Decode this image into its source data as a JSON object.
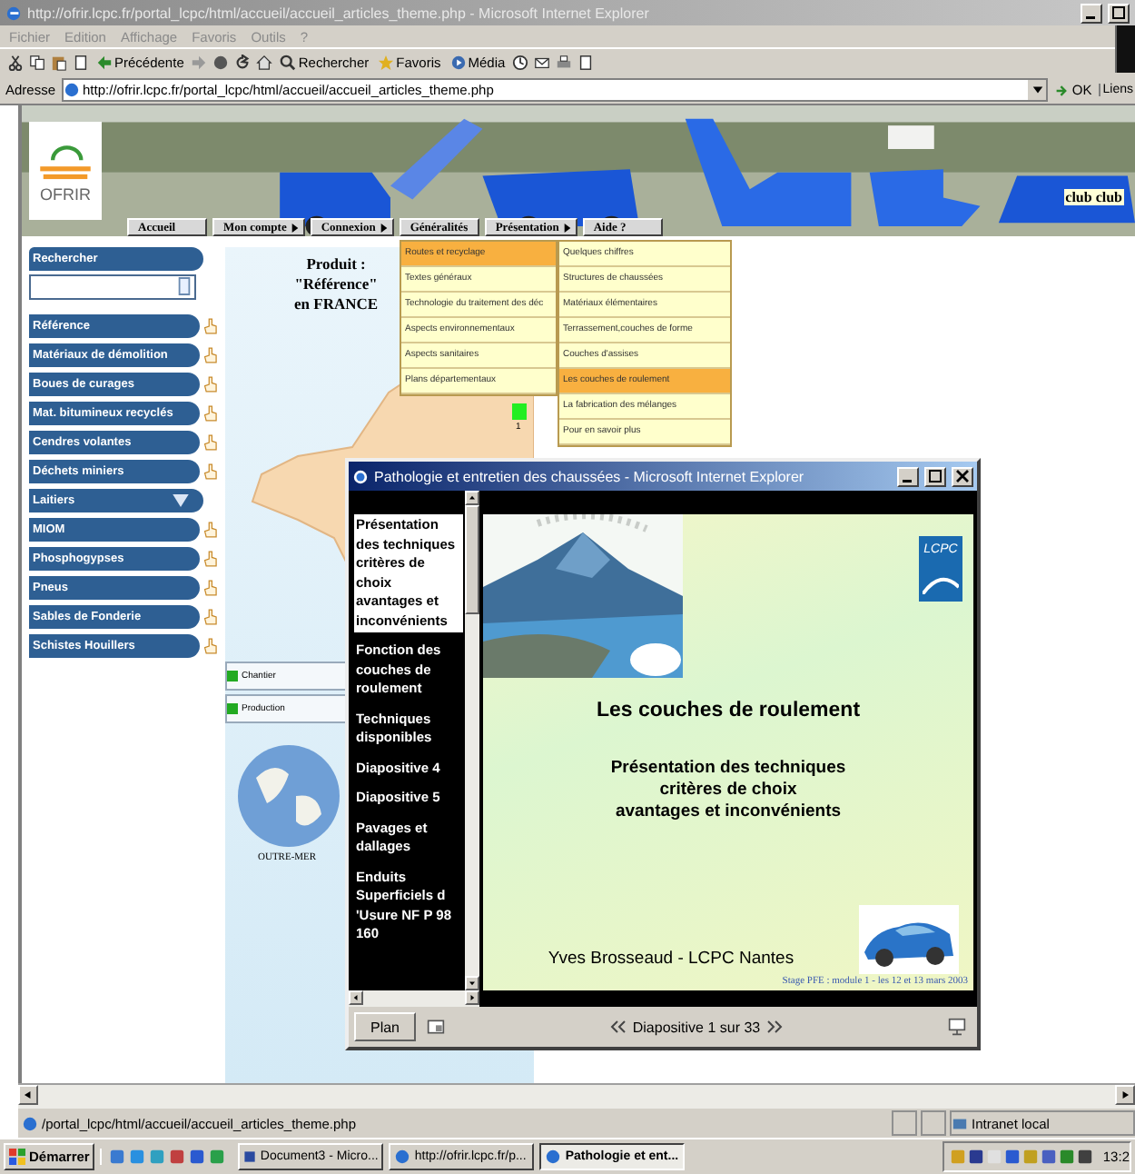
{
  "window": {
    "title": "http://ofrir.lcpc.fr/portal_lcpc/html/accueil/accueil_articles_theme.php - Microsoft Internet Explorer"
  },
  "menu_bar": [
    "Fichier",
    "Edition",
    "Affichage",
    "Favoris",
    "Outils",
    "?"
  ],
  "toolbar": [
    {
      "kind": "cut"
    },
    {
      "kind": "copy"
    },
    {
      "kind": "paste"
    },
    {
      "kind": "preview"
    },
    {
      "kind": "back",
      "label": "Précédente"
    },
    {
      "kind": "forward"
    },
    {
      "kind": "stop"
    },
    {
      "kind": "refresh"
    },
    {
      "kind": "home"
    },
    {
      "kind": "search",
      "label": "Rechercher"
    },
    {
      "kind": "favorites",
      "label": "Favoris"
    },
    {
      "kind": "media",
      "label": "Média"
    },
    {
      "kind": "history"
    },
    {
      "kind": "mail"
    },
    {
      "kind": "print"
    },
    {
      "kind": "edit"
    }
  ],
  "address_bar": {
    "label": "Adresse",
    "value": "http://ofrir.lcpc.fr/portal_lcpc/html/accueil/accueil_articles_theme.php",
    "go": "OK",
    "links": "Liens"
  },
  "site": {
    "logo": "OFRIR",
    "club": "club club",
    "nav": [
      {
        "label": "Accueil",
        "arrow": false
      },
      {
        "label": "Mon compte",
        "arrow": true
      },
      {
        "label": "Connexion",
        "arrow": true
      },
      {
        "label": "Généralités",
        "arrow": false
      },
      {
        "label": "Présentation",
        "arrow": true
      },
      {
        "label": "Aide ?",
        "arrow": false
      }
    ],
    "dropdown": {
      "column_1": [
        {
          "label": "Routes et recyclage",
          "selected": true
        },
        {
          "label": "Textes généraux",
          "selected": false
        },
        {
          "label": "Technologie du traitement des déc",
          "selected": false
        },
        {
          "label": "Aspects environnementaux",
          "selected": false
        },
        {
          "label": "Aspects sanitaires",
          "selected": false
        },
        {
          "label": "Plans départementaux",
          "selected": false
        }
      ],
      "column_2": [
        {
          "label": "Quelques chiffres",
          "selected": false
        },
        {
          "label": "Structures de chaussées",
          "selected": false
        },
        {
          "label": "Matériaux élémentaires",
          "selected": false
        },
        {
          "label": "Terrassement,couches de forme",
          "selected": false
        },
        {
          "label": "Couches d'assises",
          "selected": false
        },
        {
          "label": "Les couches de roulement",
          "selected": true
        },
        {
          "label": "La fabrication des mélanges",
          "selected": false
        },
        {
          "label": "Pour en savoir plus",
          "selected": false
        }
      ]
    },
    "sidebar": {
      "search_label": "Rechercher",
      "items": [
        {
          "label": "Référence",
          "kind": "link"
        },
        {
          "label": "Matériaux de démolition",
          "kind": "link"
        },
        {
          "label": "Boues de curages",
          "kind": "link"
        },
        {
          "label": "Mat. bitumineux recyclés",
          "kind": "link"
        },
        {
          "label": "Cendres volantes",
          "kind": "link"
        },
        {
          "label": "Déchets miniers",
          "kind": "link"
        },
        {
          "label": "Laitiers",
          "kind": "submenu"
        },
        {
          "label": "MIOM",
          "kind": "link"
        },
        {
          "label": "Phosphogypses",
          "kind": "link"
        },
        {
          "label": "Pneus",
          "kind": "link"
        },
        {
          "label": "Sables de Fonderie",
          "kind": "link"
        },
        {
          "label": "Schistes Houillers",
          "kind": "link"
        }
      ]
    },
    "map": {
      "heading": [
        "Produit :",
        "\"Référence\"",
        "en FRANCE"
      ],
      "marker_label": "1",
      "legend": [
        "Chantier",
        "Production"
      ],
      "overseas": "OUTRE-MER"
    }
  },
  "popup": {
    "title": "Pathologie et entretien des chaussées - Microsoft Internet Explorer",
    "outline": [
      {
        "label": "Présentation des techniques critères de choix avantages et inconvénients",
        "selected": true
      },
      {
        "label": "Fonction des couches de roulement",
        "selected": false
      },
      {
        "label": "Techniques disponibles",
        "selected": false
      },
      {
        "label": "Diapositive 4",
        "selected": false
      },
      {
        "label": "Diapositive 5",
        "selected": false
      },
      {
        "label": "Pavages et dallages",
        "selected": false
      },
      {
        "label": "Enduits Superficiels d 'Usure NF P 98 160",
        "selected": false
      }
    ],
    "slide": {
      "logo": "LCPC",
      "title": "Les couches de roulement",
      "subtitle": [
        "Présentation des techniques",
        "critères de choix",
        "avantages et inconvénients"
      ],
      "author": "Yves Brosseaud - LCPC Nantes",
      "footer": "Stage PFE : module 1 - les 12 et 13 mars 2003"
    },
    "plan_button": "Plan",
    "slide_counter": "Diapositive 1 sur 33"
  },
  "status_bar": {
    "text": "/portal_lcpc/html/accueil/accueil_articles_theme.php",
    "zone": "Intranet local"
  },
  "taskbar": {
    "start": "Démarrer",
    "tasks": [
      {
        "label": "Document3 - Micro...",
        "kind": "word",
        "selected": false
      },
      {
        "label": "http://ofrir.lcpc.fr/p...",
        "kind": "browser",
        "selected": false
      },
      {
        "label": "Pathologie et ent...",
        "kind": "browser",
        "selected": true
      }
    ],
    "clock": "13:2"
  }
}
